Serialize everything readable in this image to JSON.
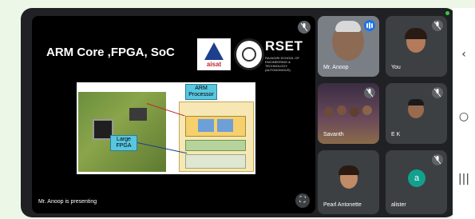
{
  "presentation": {
    "slide_title": "ARM Core ,FPGA, SoC",
    "logo_aisat_text": "aisat",
    "logo_rset_name": "RSET",
    "logo_rset_subtitle": "RAJAGIRI SCHOOL OF ENGINEERING & TECHNOLOGY (AUTONOMOUS)",
    "callout_arm": "ARM Processor",
    "callout_fpga": "Large FPGA",
    "presenter_status": "Mr. Anoop is presenting"
  },
  "participants": [
    {
      "name": "Mr. Anoop",
      "state": "speaking"
    },
    {
      "name": "You",
      "state": "muted"
    },
    {
      "name": "Savanth",
      "state": "muted"
    },
    {
      "name": "E K",
      "state": "muted"
    },
    {
      "name": "Pearl Antonette",
      "state": "muted"
    },
    {
      "name": "alister",
      "state": "muted",
      "avatar_letter": "a"
    }
  ],
  "colors": {
    "background": "#202124",
    "tile": "#3c4043",
    "speaking_blue": "#1a73e8",
    "avatar_teal": "#12a18e"
  },
  "icons": {
    "mute": "mic-off-icon",
    "speaking": "speaking-indicator-icon",
    "fullscreen": "fullscreen-icon",
    "nav_back": "chevron-left-icon",
    "nav_home": "circle-home-icon",
    "nav_recents": "recents-icon"
  }
}
